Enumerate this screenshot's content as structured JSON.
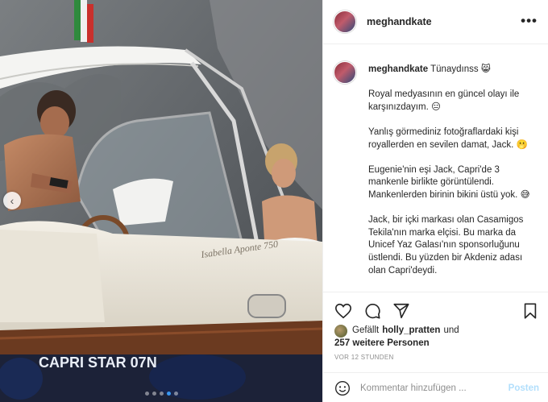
{
  "post": {
    "author": "meghandkate",
    "more_icon": "more-horizontal-icon",
    "caption": {
      "username": "meghandkate",
      "greeting": "Tünaydınss 😸",
      "paragraphs": [
        "Royal medyasının en güncel olayı ile karşınızdayım. 😑",
        "Yanlış görmediniz fotoğraflardaki kişi royallerden en sevilen damat, Jack. 🫢",
        "Eugenie'nin eşi Jack, Capri'de 3 mankenle birlikte görüntülendi. Mankenlerden birinin bikini üstü yok. 😅",
        "Jack, bir içki markası olan Casamigos Tekila'nın marka elçisi. Bu marka da Unicef Yaz Galası'nın sponsorluğunu üstlendi. Bu yüzden bir Akdeniz adası olan Capri'deydi."
      ]
    },
    "likes": {
      "prefix": "Gefällt",
      "user": "holly_pratten",
      "conjunction": "und",
      "others": "257 weitere Personen"
    },
    "timestamp": "VOR 12 STUNDEN",
    "comment_placeholder": "Kommentar hinzufügen ...",
    "post_button": "Posten",
    "action_icons": [
      "heart-icon",
      "comment-icon",
      "share-icon",
      "bookmark-icon"
    ],
    "carousel": {
      "slides": 5,
      "active": 4
    },
    "photo": {
      "boat_text": "CAPRI STAR 07N",
      "hull_text": "Isabella Aponte 750"
    }
  },
  "colors": {
    "accent": "#3897f0",
    "post_button_disabled": "#b2dffc",
    "muted": "#8e8e8e"
  }
}
